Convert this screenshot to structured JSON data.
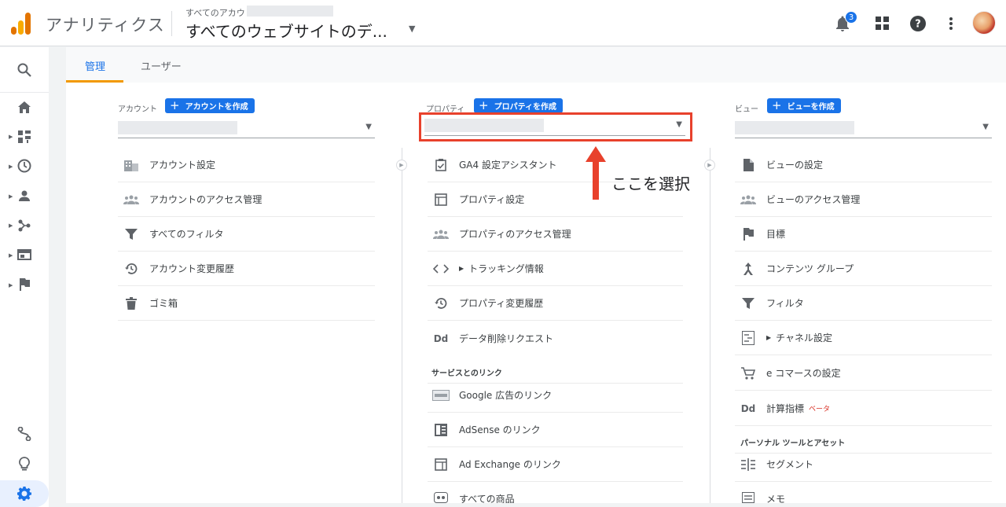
{
  "header": {
    "app_title": "アナリティクス",
    "account_small": "すべてのアカウ",
    "account_main": "すべてのウェブサイトのデ...",
    "notification_count": "3"
  },
  "tabs": [
    {
      "label": "管理",
      "active": true
    },
    {
      "label": "ユーザー",
      "active": false
    }
  ],
  "account": {
    "label": "アカウント",
    "create_label": "アカウントを作成",
    "items": [
      {
        "icon": "building-icon",
        "label": "アカウント設定"
      },
      {
        "icon": "people-icon",
        "label": "アカウントのアクセス管理"
      },
      {
        "icon": "filter-icon",
        "label": "すべてのフィルタ"
      },
      {
        "icon": "history-icon",
        "label": "アカウント変更履歴"
      },
      {
        "icon": "trash-icon",
        "label": "ゴミ箱"
      }
    ]
  },
  "property": {
    "label": "プロパティ",
    "create_label": "プロパティを作成",
    "items": [
      {
        "icon": "checklist-icon",
        "label": "GA4 設定アシスタント"
      },
      {
        "icon": "layout-icon",
        "label": "プロパティ設定"
      },
      {
        "icon": "people-icon",
        "label": "プロパティのアクセス管理"
      },
      {
        "icon": "code-icon",
        "label": "トラッキング情報"
      },
      {
        "icon": "history-icon",
        "label": "プロパティ変更履歴"
      },
      {
        "icon": "dd-icon",
        "label": "データ削除リクエスト"
      }
    ],
    "links_section": "サービスとのリンク",
    "links": [
      {
        "icon": "google-ads-icon",
        "label": "Google 広告のリンク"
      },
      {
        "icon": "adsense-icon",
        "label": "AdSense のリンク"
      },
      {
        "icon": "adexchange-icon",
        "label": "Ad Exchange のリンク"
      },
      {
        "icon": "products-icon",
        "label": "すべての商品"
      }
    ]
  },
  "view": {
    "label": "ビュー",
    "create_label": "ビューを作成",
    "items": [
      {
        "icon": "document-icon",
        "label": "ビューの設定"
      },
      {
        "icon": "people-icon",
        "label": "ビューのアクセス管理"
      },
      {
        "icon": "flag-icon",
        "label": "目標"
      },
      {
        "icon": "content-group-icon",
        "label": "コンテンツ グループ"
      },
      {
        "icon": "filter-icon",
        "label": "フィルタ"
      },
      {
        "icon": "channel-icon",
        "label": "チャネル設定"
      },
      {
        "icon": "cart-icon",
        "label": "e コマースの設定"
      },
      {
        "icon": "dd-icon",
        "label": "計算指標",
        "badge": "ベータ"
      }
    ],
    "personal_section": "パーソナル ツールとアセット",
    "personal": [
      {
        "icon": "segment-icon",
        "label": "セグメント"
      },
      {
        "icon": "memo-icon",
        "label": "メモ"
      }
    ]
  },
  "annotation": {
    "text": "ここを選択",
    "color": "#e8412c"
  },
  "colors": {
    "accent": "#1a73e8",
    "tab_underline": "#f29900"
  }
}
